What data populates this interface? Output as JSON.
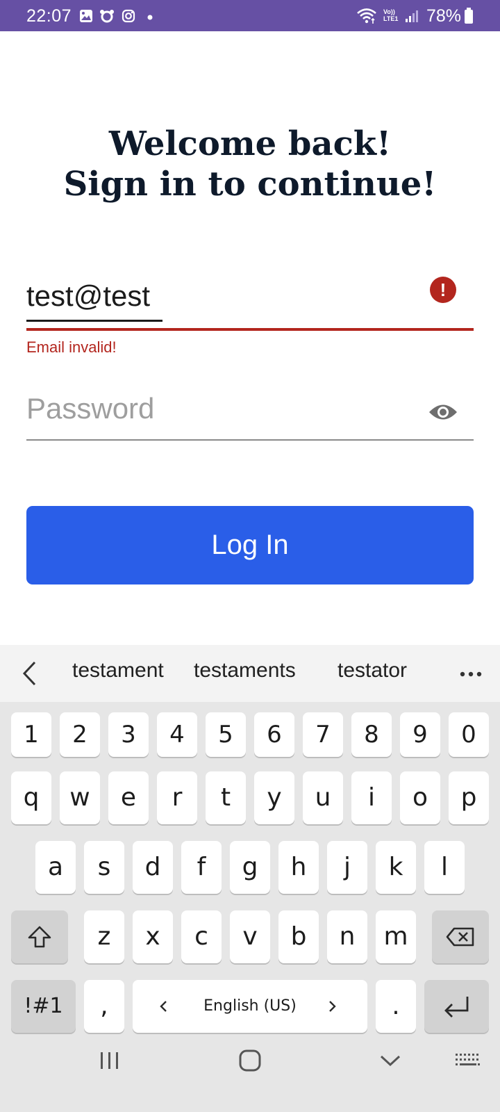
{
  "status_bar": {
    "time": "22:07",
    "battery_percent": "78%",
    "network_label": "Vo)) LTE1",
    "background": "#6650a4"
  },
  "header": {
    "line1": "Welcome back!",
    "line2": "Sign in to continue!"
  },
  "email": {
    "value": "test@test",
    "error": "Email invalid!",
    "error_color": "#b3261e"
  },
  "password": {
    "placeholder": "Password"
  },
  "login_button": {
    "label": "Log In",
    "color": "#2a5ee8"
  },
  "suggestions": [
    "testament",
    "testaments",
    "testator"
  ],
  "keyboard": {
    "number_row": [
      "1",
      "2",
      "3",
      "4",
      "5",
      "6",
      "7",
      "8",
      "9",
      "0"
    ],
    "row1": [
      "q",
      "w",
      "e",
      "r",
      "t",
      "y",
      "u",
      "i",
      "o",
      "p"
    ],
    "row2": [
      "a",
      "s",
      "d",
      "f",
      "g",
      "h",
      "j",
      "k",
      "l"
    ],
    "row3": [
      "z",
      "x",
      "c",
      "v",
      "b",
      "n",
      "m"
    ],
    "symbols_label": "!#1",
    "comma": ",",
    "period": ".",
    "language": "English (US)"
  }
}
